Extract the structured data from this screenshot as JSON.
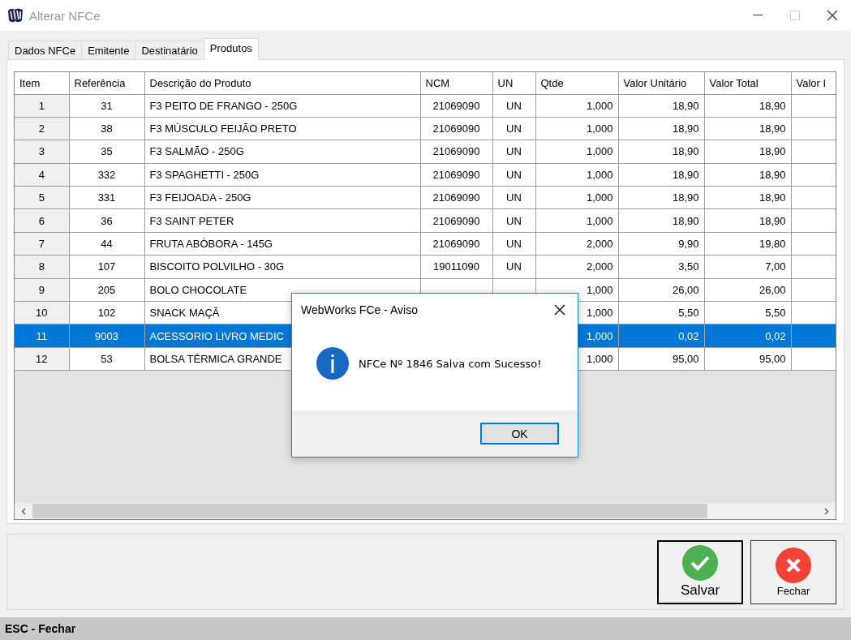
{
  "window": {
    "title": "Alterar NFCe"
  },
  "tabs": [
    {
      "label": "Dados NFCe",
      "selected": false
    },
    {
      "label": "Emitente",
      "selected": false
    },
    {
      "label": "Destinatário",
      "selected": false
    },
    {
      "label": "Produtos",
      "selected": true
    }
  ],
  "table": {
    "columns": [
      "Item",
      "Referência",
      "Descrição do Produto",
      "NCM",
      "UN",
      "Qtde",
      "Valor Unitário",
      "Valor Total",
      "Valor I"
    ],
    "rows": [
      {
        "cells": [
          "1",
          "31",
          "F3 PEITO DE FRANGO - 250G",
          "21069090",
          "UN",
          "1,000",
          "18,90",
          "18,90"
        ],
        "selected": false
      },
      {
        "cells": [
          "2",
          "38",
          "F3 MÚSCULO FEIJÃO PRETO",
          "21069090",
          "UN",
          "1,000",
          "18,90",
          "18,90"
        ],
        "selected": false
      },
      {
        "cells": [
          "3",
          "35",
          "F3 SALMÃO - 250G",
          "21069090",
          "UN",
          "1,000",
          "18,90",
          "18,90"
        ],
        "selected": false
      },
      {
        "cells": [
          "4",
          "332",
          "F3 SPAGHETTI - 250G",
          "21069090",
          "UN",
          "1,000",
          "18,90",
          "18,90"
        ],
        "selected": false
      },
      {
        "cells": [
          "5",
          "331",
          "F3 FEIJOADA - 250G",
          "21069090",
          "UN",
          "1,000",
          "18,90",
          "18,90"
        ],
        "selected": false
      },
      {
        "cells": [
          "6",
          "36",
          "F3 SAINT PETER",
          "21069090",
          "UN",
          "1,000",
          "18,90",
          "18,90"
        ],
        "selected": false
      },
      {
        "cells": [
          "7",
          "44",
          "FRUTA ABÓBORA - 145G",
          "21069090",
          "UN",
          "2,000",
          "9,90",
          "19,80"
        ],
        "selected": false
      },
      {
        "cells": [
          "8",
          "107",
          "BISCOITO POLVILHO - 30G",
          "19011090",
          "UN",
          "2,000",
          "3,50",
          "7,00"
        ],
        "selected": false
      },
      {
        "cells": [
          "9",
          "205",
          "BOLO CHOCOLATE",
          null,
          null,
          "1,000",
          "26,00",
          "26,00"
        ],
        "selected": false
      },
      {
        "cells": [
          "10",
          "102",
          "SNACK MAÇÃ",
          null,
          null,
          "1,000",
          "5,50",
          "5,50"
        ],
        "selected": false
      },
      {
        "cells": [
          "11",
          "9003",
          "ACESSORIO LIVRO MEDIC",
          null,
          null,
          "1,000",
          "0,02",
          "0,02"
        ],
        "selected": true
      },
      {
        "cells": [
          "12",
          "53",
          "BOLSA TÉRMICA GRANDE",
          null,
          null,
          "1,000",
          "95,00",
          "95,00"
        ],
        "selected": false
      }
    ]
  },
  "dialog": {
    "title": "WebWorks FCe - Aviso",
    "message": "NFCe Nº 1846 Salva com Sucesso!",
    "button": "OK"
  },
  "actions": [
    {
      "label": "Salvar",
      "kind": "confirm",
      "default": true
    },
    {
      "label": "Fechar",
      "kind": "cancel",
      "default": false
    }
  ],
  "status_bar": {
    "text": "ESC - Fechar"
  }
}
